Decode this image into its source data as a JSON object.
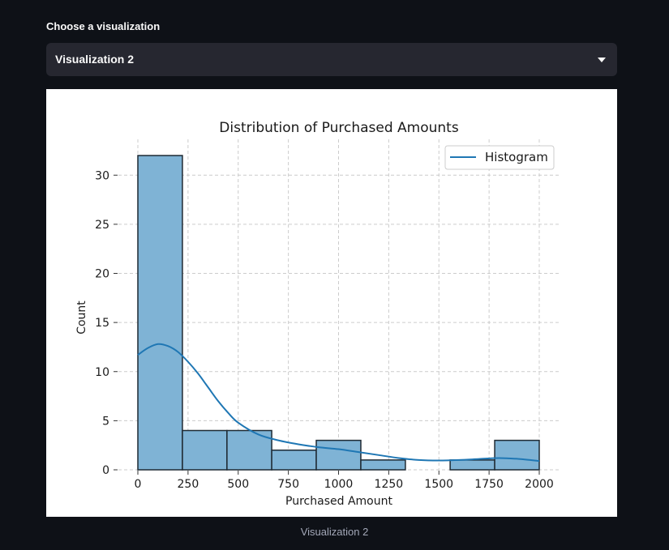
{
  "select": {
    "label": "Choose a visualization",
    "value": "Visualization 2"
  },
  "caption": "Visualization 2",
  "colors": {
    "bar_fill": "#7fb3d5",
    "bar_edge": "#1f2a33",
    "kde_line": "#1f77b4",
    "grid": "#cccccc",
    "background_dark": "#0e1117",
    "select_bg": "#262730"
  },
  "chart_data": {
    "type": "bar",
    "title": "Distribution of Purchased Amounts",
    "xlabel": "Purchased Amount",
    "ylabel": "Count",
    "xlim": [
      0,
      2000
    ],
    "ylim": [
      0,
      32
    ],
    "xticks": [
      0,
      250,
      500,
      750,
      1000,
      1250,
      1500,
      1750,
      2000
    ],
    "yticks": [
      0,
      5,
      10,
      15,
      20,
      25,
      30
    ],
    "grid": true,
    "legend": {
      "entries": [
        "Histogram"
      ],
      "placement": "top-right"
    },
    "bins": [
      {
        "x0": 0,
        "x1": 222,
        "count": 32
      },
      {
        "x0": 222,
        "x1": 444,
        "count": 4
      },
      {
        "x0": 444,
        "x1": 667,
        "count": 4
      },
      {
        "x0": 667,
        "x1": 889,
        "count": 2
      },
      {
        "x0": 889,
        "x1": 1111,
        "count": 3
      },
      {
        "x0": 1111,
        "x1": 1333,
        "count": 1
      },
      {
        "x0": 1333,
        "x1": 1556,
        "count": 0
      },
      {
        "x0": 1556,
        "x1": 1778,
        "count": 1
      },
      {
        "x0": 1778,
        "x1": 2000,
        "count": 3
      }
    ],
    "kde": {
      "x": [
        0,
        50,
        100,
        150,
        200,
        250,
        300,
        350,
        400,
        450,
        500,
        600,
        700,
        800,
        900,
        1000,
        1100,
        1200,
        1300,
        1400,
        1500,
        1600,
        1700,
        1800,
        1900,
        2000
      ],
      "y": [
        11.7,
        12.4,
        12.8,
        12.6,
        12.0,
        11.0,
        9.8,
        8.4,
        7.0,
        5.8,
        4.8,
        3.6,
        3.0,
        2.6,
        2.3,
        2.1,
        1.8,
        1.5,
        1.2,
        1.0,
        0.95,
        1.0,
        1.1,
        1.2,
        1.1,
        0.9
      ]
    }
  }
}
